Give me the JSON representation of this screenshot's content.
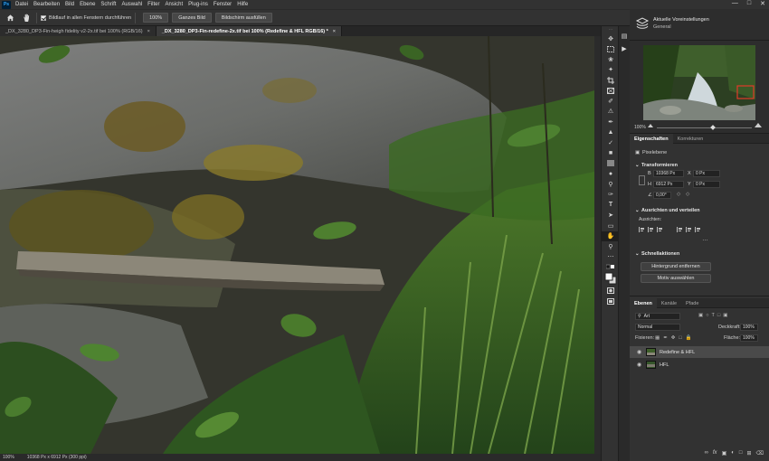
{
  "menubar": {
    "logo": "Ps",
    "items": [
      "Datei",
      "Bearbeiten",
      "Bild",
      "Ebene",
      "Schrift",
      "Auswahl",
      "Filter",
      "Ansicht",
      "Plug-ins",
      "Fenster",
      "Hilfe"
    ]
  },
  "options": {
    "scroll_all_label": "Bildlauf in allen Fenstern durchführen",
    "btn_100": "100%",
    "btn_fit": "Ganzes Bild",
    "btn_fill": "Bildschirm ausfüllen"
  },
  "tabs": [
    {
      "label": "_DX_3280_DP3-Fin-heigh fidelity v2-2x.tif bei 100% (RGB/16)",
      "active": false
    },
    {
      "label": "_DX_3280_DP3-Fin-redefine-2x.tif bei 100% (Redefine & HFL RGB/16) *",
      "active": true
    }
  ],
  "status": {
    "zoom": "100%",
    "dims": "10368 Px x 6912 Px (300 ppi)"
  },
  "learn": {
    "title": "Aktuelle Voreinstellungen",
    "subtitle": "General"
  },
  "navigator": {
    "zoom": "100%"
  },
  "properties": {
    "tabs": [
      "Eigenschaften",
      "Korrekturen"
    ],
    "layer_type": "Pixelebene",
    "transform_title": "Transformieren",
    "w_label": "B",
    "w_value": "10368 Px",
    "h_label": "H",
    "h_value": "6912 Px",
    "x_label": "X",
    "x_value": "0 Px",
    "y_label": "Y",
    "y_value": "0 Px",
    "angle_value": "0,00°",
    "align_title": "Ausrichten und verteilen",
    "align_sub": "Ausrichten:",
    "quick_title": "Schnellaktionen",
    "btn_remove_bg": "Hintergrund entfernen",
    "btn_select_subject": "Motiv auswählen"
  },
  "layers": {
    "tabs": [
      "Ebenen",
      "Kanäle",
      "Pfade"
    ],
    "filter_label": "Art",
    "blend_mode": "Normal",
    "opacity_label": "Deckkraft:",
    "opacity_value": "100%",
    "lock_label": "Fixieren:",
    "fill_label": "Fläche:",
    "fill_value": "100%",
    "items": [
      {
        "name": "Redefine & HFL",
        "selected": true
      },
      {
        "name": "HFL",
        "selected": false
      }
    ]
  },
  "colors": {
    "accent": "#31a8ff",
    "panel": "#323232",
    "app_bg": "#252525"
  },
  "icons": {
    "home": "home-icon",
    "hand": "hand-icon"
  }
}
